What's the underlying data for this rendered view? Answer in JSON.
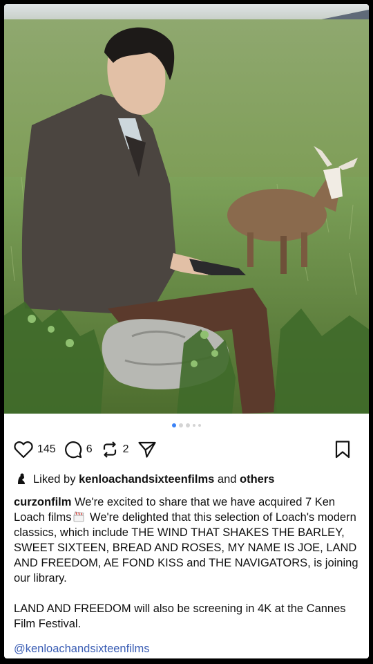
{
  "post": {
    "likes_count": "145",
    "comments_count": "6",
    "reposts_count": "2",
    "carousel": {
      "total": 5,
      "active": 0
    },
    "liked_by": {
      "prefix": "Liked by",
      "user": "kenloachandsixteenfilms",
      "connector": "and",
      "others": "others"
    },
    "caption": {
      "username": "curzonfilm",
      "text_part1": "We're excited to share that we have acquired 7 Ken Loach films",
      "text_part2": "We're delighted that this selection of Loach's modern classics, which include THE WIND THAT SHAKES THE BARLEY, SWEET SIXTEEN, BREAD AND ROSES, MY NAME IS JOE, LAND AND FREEDOM, AE FOND KISS and THE NAVIGATORS, is joining our library.",
      "paragraph2": "LAND AND FREEDOM will also be screening in 4K at the Cannes Film Festival.",
      "emoji": "clapper-board-emoji"
    },
    "mention": "@kenloachandsixteenfilms"
  },
  "icons": {
    "like": "heart-icon",
    "comment": "comment-icon",
    "repost": "repost-icon",
    "share": "send-icon",
    "save": "bookmark-icon"
  },
  "colors": {
    "carousel_active": "#3b82f6",
    "mention": "#3a5db4"
  }
}
